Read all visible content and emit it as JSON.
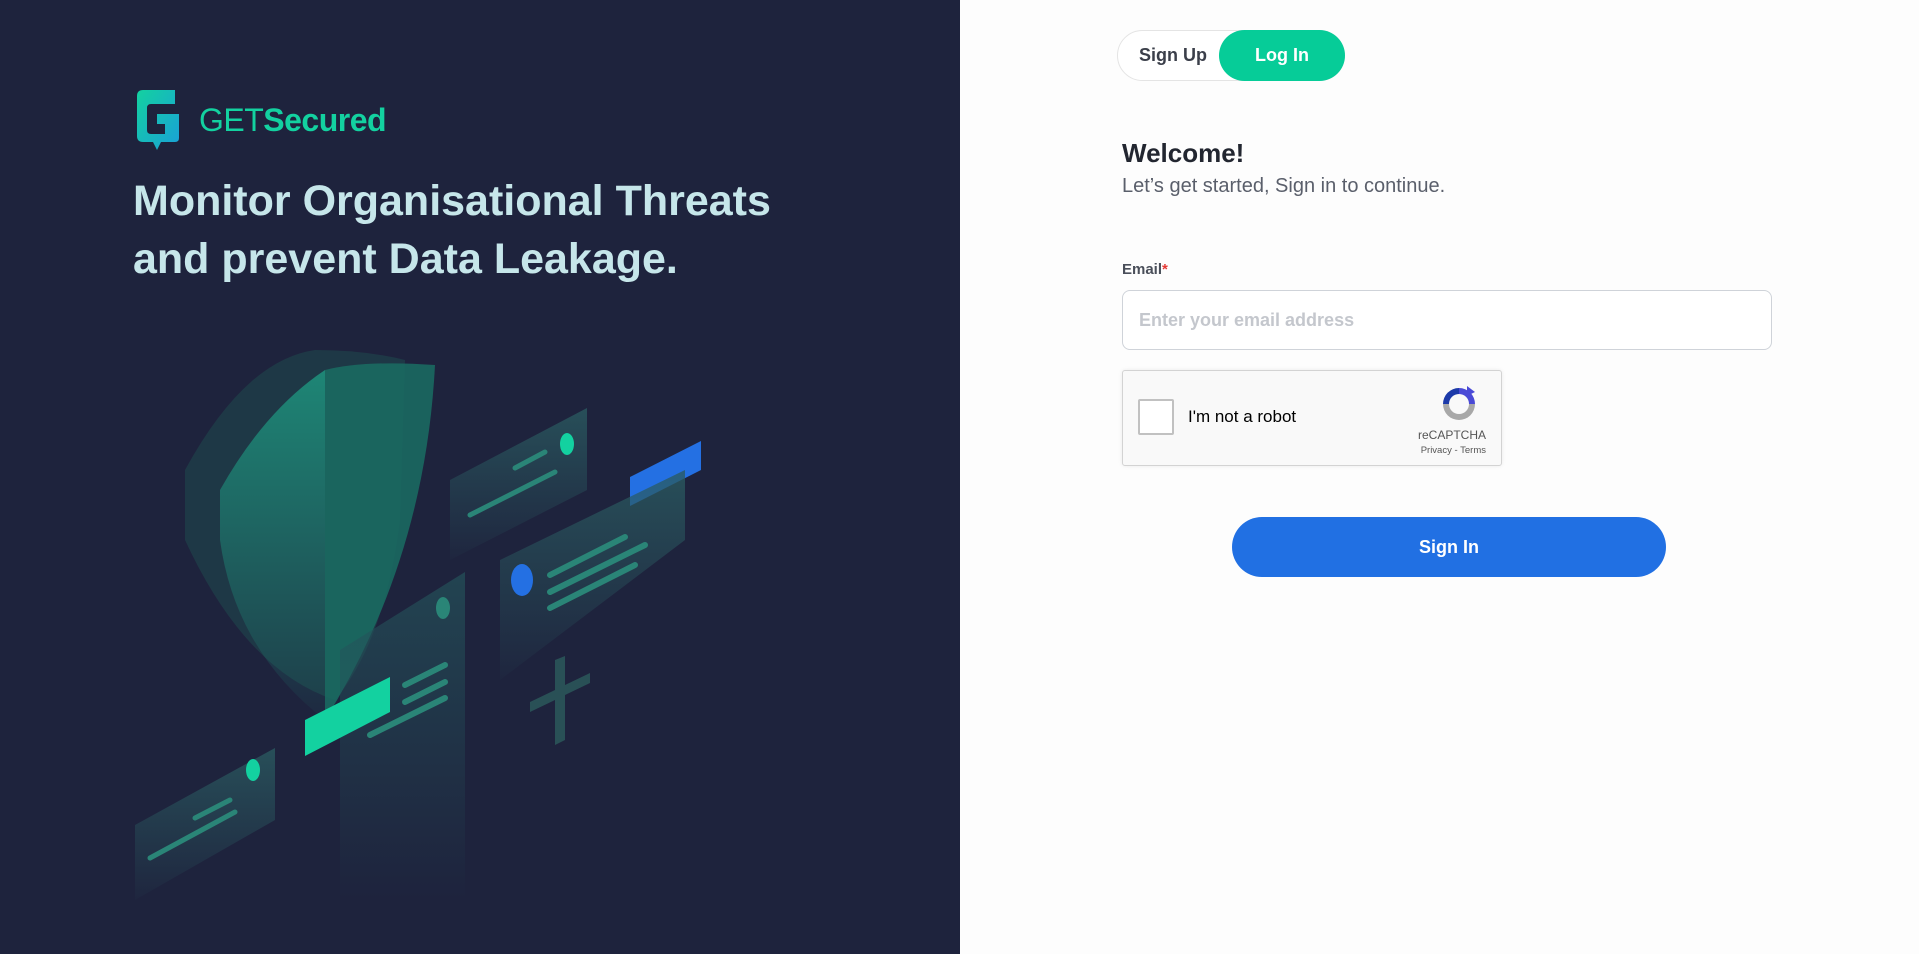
{
  "brand": {
    "name_light": "GET",
    "name_bold": "Secured",
    "accent_color": "#13d1a0"
  },
  "left_panel": {
    "headline_line1": "Monitor Organisational Threats",
    "headline_line2": "and prevent Data Leakage.",
    "background_color": "#1e233d",
    "illustration": "security-shield-illustration"
  },
  "auth_toggle": {
    "signup_label": "Sign Up",
    "login_label": "Log In",
    "active": "Log In",
    "active_color": "#06cc98"
  },
  "form": {
    "welcome": "Welcome!",
    "subtitle": "Let’s get started, Sign in to continue.",
    "email_label": "Email",
    "required_marker": "*",
    "email_placeholder": "Enter your email address",
    "email_value": ""
  },
  "recaptcha": {
    "label": "I'm not a robot",
    "brand": "reCAPTCHA",
    "privacy": "Privacy",
    "separator": " - ",
    "terms": "Terms",
    "checked": false
  },
  "submit": {
    "label": "Sign In",
    "color": "#2170e3"
  }
}
